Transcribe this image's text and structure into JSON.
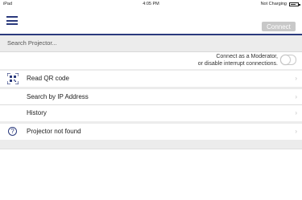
{
  "statusbar": {
    "device": "iPad",
    "time": "4:05 PM",
    "charging": "Not Charging"
  },
  "navbar": {
    "menu_icon": "hamburger-menu-icon",
    "connect_label": "Connect"
  },
  "search": {
    "label": "Search Projector..."
  },
  "moderator": {
    "line1": "Connect as a Moderator,",
    "line2": "or disable interrupt connections.",
    "toggle_on": false
  },
  "list": {
    "qr": {
      "label": "Read QR code",
      "icon": "qr-code-icon"
    },
    "ip": {
      "label": "Search by IP Address"
    },
    "history": {
      "label": "History"
    },
    "notfound": {
      "label": "Projector not found",
      "icon": "help-circle-icon"
    }
  },
  "colors": {
    "accent": "#2b3a7d",
    "connect_disabled": "#c8c8c8",
    "section_bg": "#ececec"
  }
}
